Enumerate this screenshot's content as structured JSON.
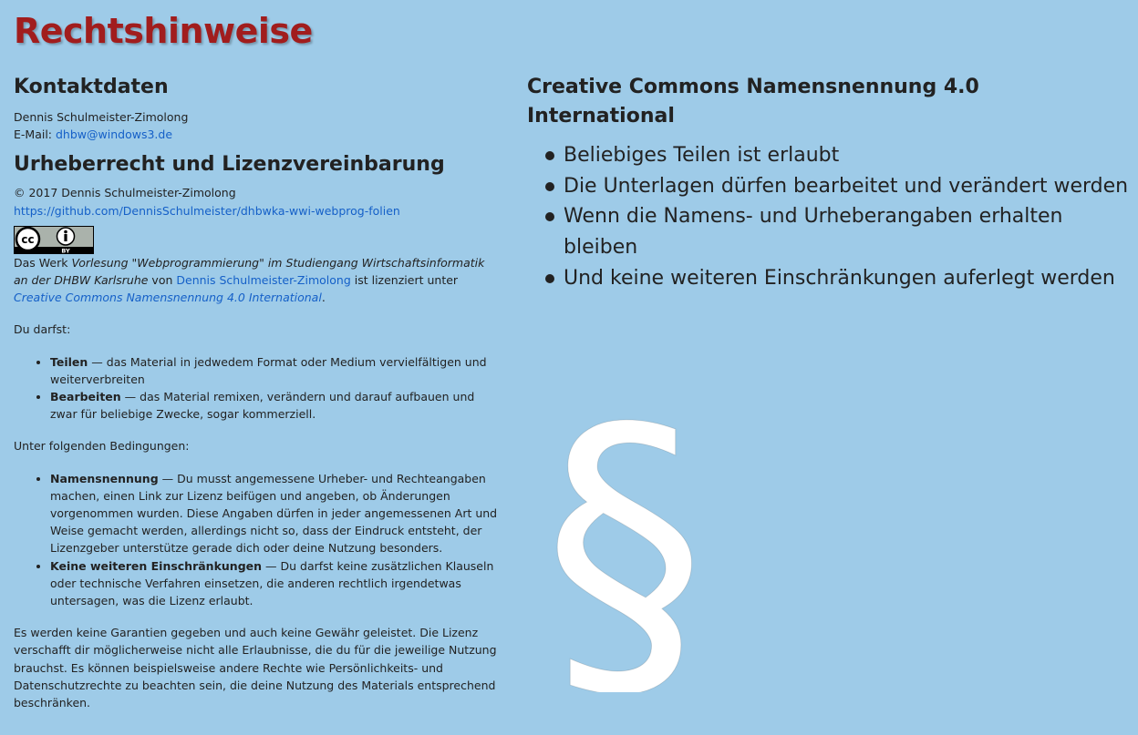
{
  "page": {
    "title": "Rechtshinweise",
    "title_color": "#a11d1d",
    "background": "#9ecbe8"
  },
  "contact": {
    "heading": "Kontaktdaten",
    "name": "Dennis Schulmeister-Zimolong",
    "email_label": "E-Mail:",
    "email": "dhbw@windows3.de"
  },
  "copyright": {
    "heading": "Urheberrecht und Lizenzvereinbarung",
    "line": "© 2017 Dennis Schulmeister-Zimolong",
    "repo_link": "https://github.com/DennisSchulmeister/dhbwka-wwi-webprog-folien",
    "badge_icon": "cc-by-icon",
    "badge_text": "BY",
    "work_prefix": "Das Werk",
    "work_title": "Vorlesung \"Webprogrammierung\" im Studiengang Wirtschaftsinformatik an der DHBW Karlsruhe",
    "work_by": "von",
    "author_link": "Dennis Schulmeister-Zimolong",
    "licensed_under": "ist lizenziert unter",
    "license_link": "Creative Commons Namensnennung 4.0 International",
    "period": ".",
    "you_may": "Du darfst:",
    "permissions": [
      {
        "term": "Teilen",
        "text": "— das Material in jedwedem Format oder Medium vervielfältigen und weiterverbreiten"
      },
      {
        "term": "Bearbeiten",
        "text": "— das Material remixen, verändern und darauf aufbauen und zwar für beliebige Zwecke, sogar kommerziell."
      }
    ],
    "conditions_intro": "Unter folgenden Bedingungen:",
    "conditions": [
      {
        "term": "Namensnennung",
        "text": "— Du musst angemessene Urheber- und Rechteangaben machen, einen Link zur Lizenz beifügen und angeben, ob Änderungen vorgenommen wurden. Diese Angaben dürfen in jeder angemessenen Art und Weise gemacht werden, allerdings nicht so, dass der Eindruck entsteht, der Lizenzgeber unterstütze gerade dich oder deine Nutzung besonders."
      },
      {
        "term": "Keine weiteren Einschränkungen",
        "text": "— Du darfst keine zusätzlichen Klauseln oder technische Verfahren einsetzen, die anderen rechtlich irgendetwas untersagen, was die Lizenz erlaubt."
      }
    ],
    "disclaimer": "Es werden keine Garantien gegeben und auch keine Gewähr geleistet. Die Lizenz verschafft dir möglicherweise nicht alle Erlaubnisse, die du für die jeweilige Nutzung brauchst. Es können beispielsweise andere Rechte wie Persönlichkeits- und Datenschutzrechte zu beachten sein, die deine Nutzung des Materials entsprechend beschränken."
  },
  "summary": {
    "heading": "Creative Commons Namensnennung 4.0 International",
    "items": [
      "Beliebiges Teilen ist erlaubt",
      "Die Unterlagen dürfen bearbeitet und verändert werden",
      "Wenn die Namens- und Urheberangaben erhalten bleiben",
      "Und keine weiteren Einschränkungen auferlegt werden"
    ]
  },
  "decoration": {
    "icon": "paragraph-sign-icon",
    "glyph": "§"
  }
}
